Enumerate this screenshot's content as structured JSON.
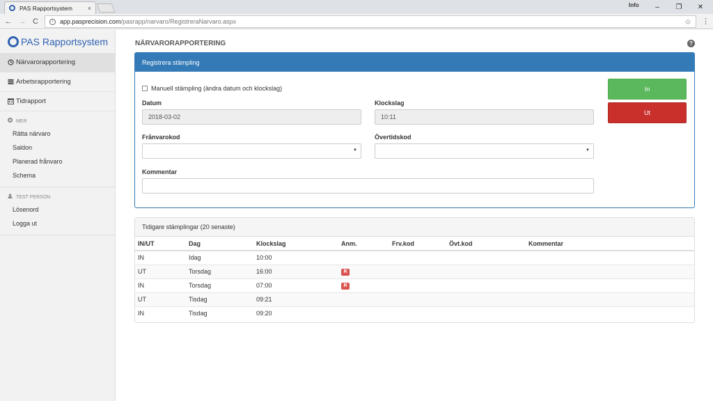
{
  "browser": {
    "tab_title": "PAS Rapportsystem",
    "tab_close": "×",
    "user_label": "Info",
    "minimize": "–",
    "restore": "❐",
    "close": "✕",
    "url_host": "app.pasprecision.com",
    "url_path": "/pasrapp/narvaro/RegistreraNarvaro.aspx",
    "back": "←",
    "forward": "→",
    "reload": "C",
    "star": "☆",
    "menu": "⋮"
  },
  "sidebar": {
    "brand": "PAS Rapportsystem",
    "nav": [
      {
        "label": "Närvarorapportering",
        "icon": "clock-icon"
      },
      {
        "label": "Arbetsrapportering",
        "icon": "list-icon"
      },
      {
        "label": "Tidrapport",
        "icon": "calendar-icon"
      }
    ],
    "more_section": "MER",
    "more_items": [
      "Rätta närvaro",
      "Saldon",
      "Planerad frånvaro",
      "Schema"
    ],
    "user_section": "TEST PERSON",
    "user_items": [
      "Lösenord",
      "Logga ut"
    ]
  },
  "page": {
    "title": "NÄRVARORAPPORTERING",
    "help": "?"
  },
  "form": {
    "panel_title": "Registrera stämpling",
    "manual_label": "Manuell stämpling (ändra datum och klockslag)",
    "date_label": "Datum",
    "date_value": "2018-03-02",
    "time_label": "Klockslag",
    "time_value": "10:11",
    "absence_label": "Frånvarokod",
    "overtime_label": "Övertidskod",
    "comment_label": "Kommentar",
    "in_button": "In",
    "out_button": "Ut"
  },
  "history": {
    "title": "Tidigare stämplingar (20 senaste)",
    "columns": [
      "IN/UT",
      "Dag",
      "Klockslag",
      "Anm.",
      "Frv.kod",
      "Övt.kod",
      "Kommentar"
    ],
    "rows": [
      {
        "inout": "IN",
        "day": "Idag",
        "time": "10:00",
        "note": ""
      },
      {
        "inout": "UT",
        "day": "Torsdag",
        "time": "16:00",
        "note": "R"
      },
      {
        "inout": "IN",
        "day": "Torsdag",
        "time": "07:00",
        "note": "R"
      },
      {
        "inout": "UT",
        "day": "Tisdag",
        "time": "09:21",
        "note": ""
      },
      {
        "inout": "IN",
        "day": "Tisdag",
        "time": "09:20",
        "note": ""
      }
    ]
  },
  "colors": {
    "primary": "#337ab7",
    "success": "#5cb85c",
    "danger": "#c9302c",
    "badge": "#d9534f",
    "brand": "#2f62b1"
  }
}
